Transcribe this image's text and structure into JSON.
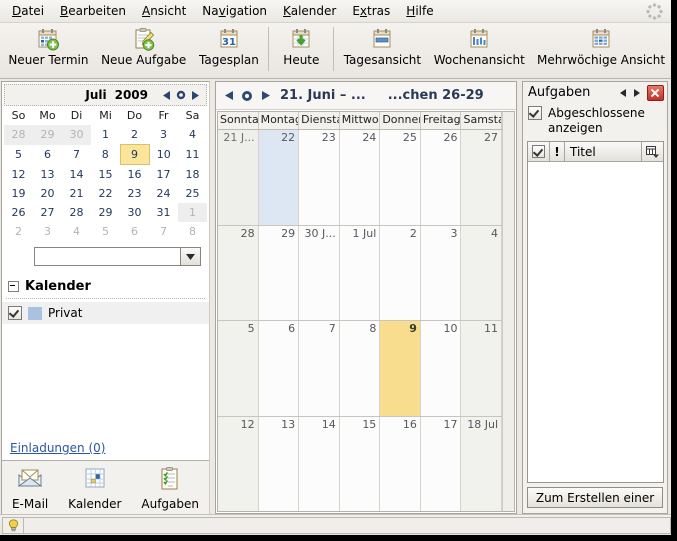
{
  "menu": {
    "items": [
      {
        "label": "Datei",
        "accel": "D"
      },
      {
        "label": "Bearbeiten",
        "accel": "B"
      },
      {
        "label": "Ansicht",
        "accel": "A"
      },
      {
        "label": "Navigation",
        "accel": "v"
      },
      {
        "label": "Kalender",
        "accel": "K"
      },
      {
        "label": "Extras",
        "accel": "x"
      },
      {
        "label": "Hilfe",
        "accel": "H"
      }
    ],
    "throbber_icon": "activity-throbber-icon"
  },
  "toolbar": {
    "buttons": [
      {
        "label": "Neuer Termin",
        "icon": "new-event-icon"
      },
      {
        "label": "Neue Aufgabe",
        "icon": "new-task-icon"
      },
      {
        "label": "Tagesplan",
        "icon": "day-plan-icon"
      },
      {
        "label": "Heute",
        "icon": "today-icon"
      },
      {
        "label": "Tagesansicht",
        "icon": "day-view-icon"
      },
      {
        "label": "Wochenansicht",
        "icon": "week-view-icon"
      },
      {
        "label": "Mehrwöchige Ansicht",
        "icon": "multiweek-view-icon"
      }
    ]
  },
  "sidebar": {
    "minicalendar": {
      "month": "Juli",
      "year": "2009",
      "prev_icon": "triangle-left-icon",
      "today_icon": "circle-icon",
      "next_icon": "triangle-right-icon",
      "weekdays": [
        "So",
        "Mo",
        "Di",
        "Mi",
        "Do",
        "Fr",
        "Sa"
      ],
      "weeks": [
        [
          {
            "d": "28",
            "out": true
          },
          {
            "d": "29",
            "out": true
          },
          {
            "d": "30",
            "out": true
          },
          {
            "d": "1"
          },
          {
            "d": "2"
          },
          {
            "d": "3"
          },
          {
            "d": "4"
          }
        ],
        [
          {
            "d": "5"
          },
          {
            "d": "6"
          },
          {
            "d": "7"
          },
          {
            "d": "8"
          },
          {
            "d": "9",
            "today": true
          },
          {
            "d": "10"
          },
          {
            "d": "11"
          }
        ],
        [
          {
            "d": "12"
          },
          {
            "d": "13"
          },
          {
            "d": "14"
          },
          {
            "d": "15"
          },
          {
            "d": "16"
          },
          {
            "d": "17"
          },
          {
            "d": "18"
          }
        ],
        [
          {
            "d": "19"
          },
          {
            "d": "20"
          },
          {
            "d": "21"
          },
          {
            "d": "22"
          },
          {
            "d": "23"
          },
          {
            "d": "24"
          },
          {
            "d": "25"
          }
        ],
        [
          {
            "d": "26"
          },
          {
            "d": "27"
          },
          {
            "d": "28"
          },
          {
            "d": "29"
          },
          {
            "d": "30"
          },
          {
            "d": "31"
          },
          {
            "d": "1",
            "out": true
          }
        ],
        [
          {
            "d": "2",
            "out": true
          },
          {
            "d": "3",
            "out": true
          },
          {
            "d": "4",
            "out": true
          },
          {
            "d": "5",
            "out": true
          },
          {
            "d": "6",
            "out": true
          },
          {
            "d": "7",
            "out": true
          },
          {
            "d": "8",
            "out": true
          }
        ]
      ]
    },
    "search": {
      "value": "",
      "placeholder": "",
      "dropdown_icon": "chevron-down-icon"
    },
    "calendars_section": {
      "title": "Kalender",
      "twisty_icon": "collapse-twisty-icon",
      "items": [
        {
          "name": "Privat",
          "checked": true,
          "color": "#a8c3e0"
        }
      ]
    },
    "invitations_link": "Einladungen (0)",
    "modebar": [
      {
        "label": "E-Mail",
        "icon": "mail-icon"
      },
      {
        "label": "Kalender",
        "icon": "calendar-icon"
      },
      {
        "label": "Aufgaben",
        "icon": "tasks-icon"
      }
    ]
  },
  "calendar": {
    "prev_icon": "triangle-left-icon",
    "today_icon": "circle-icon",
    "next_icon": "triangle-right-icon",
    "title": "21. Juni – ...",
    "title2": "...chen 26-29",
    "weekday_headers": [
      "Sonntag",
      "Montag",
      "Dienstag",
      "Mittwoch",
      "Donnerstag",
      "Freitag",
      "Samstag"
    ],
    "weeks": [
      [
        {
          "label": "21 J...",
          "weekend": true
        },
        {
          "label": "22",
          "selected": true
        },
        {
          "label": "23"
        },
        {
          "label": "24"
        },
        {
          "label": "25"
        },
        {
          "label": "26"
        },
        {
          "label": "27",
          "weekend": true
        }
      ],
      [
        {
          "label": "28",
          "weekend": true
        },
        {
          "label": "29"
        },
        {
          "label": "30 J..."
        },
        {
          "label": "1 Jul"
        },
        {
          "label": "2"
        },
        {
          "label": "3"
        },
        {
          "label": "4",
          "weekend": true
        }
      ],
      [
        {
          "label": "5",
          "weekend": true
        },
        {
          "label": "6"
        },
        {
          "label": "7"
        },
        {
          "label": "8"
        },
        {
          "label": "9",
          "today": true
        },
        {
          "label": "10"
        },
        {
          "label": "11",
          "weekend": true
        }
      ],
      [
        {
          "label": "12",
          "weekend": true
        },
        {
          "label": "13"
        },
        {
          "label": "14"
        },
        {
          "label": "15"
        },
        {
          "label": "16"
        },
        {
          "label": "17"
        },
        {
          "label": "18 Jul",
          "weekend": true
        }
      ]
    ]
  },
  "taskpane": {
    "title": "Aufgaben",
    "prev_icon": "triangle-left-icon",
    "next_icon": "triangle-right-icon",
    "close_icon": "close-icon",
    "filter": {
      "label": "Abgeschlossene anzeigen",
      "checked": true
    },
    "columns": {
      "completed_icon": "checkmark-column-icon",
      "priority_icon": "priority-exclamation-icon",
      "title": "Titel",
      "picker_icon": "column-picker-icon"
    },
    "rows": [],
    "create_button": "Zum Erstellen einer"
  },
  "statusbar": {
    "tip_icon": "lightbulb-icon",
    "text": ""
  },
  "colors": {
    "today_highlight": "#f8dd8f",
    "selected_day": "#dce7f3",
    "calendar_privat": "#a8c3e0",
    "link": "#2b55a0",
    "title_text": "#2a3a55"
  }
}
